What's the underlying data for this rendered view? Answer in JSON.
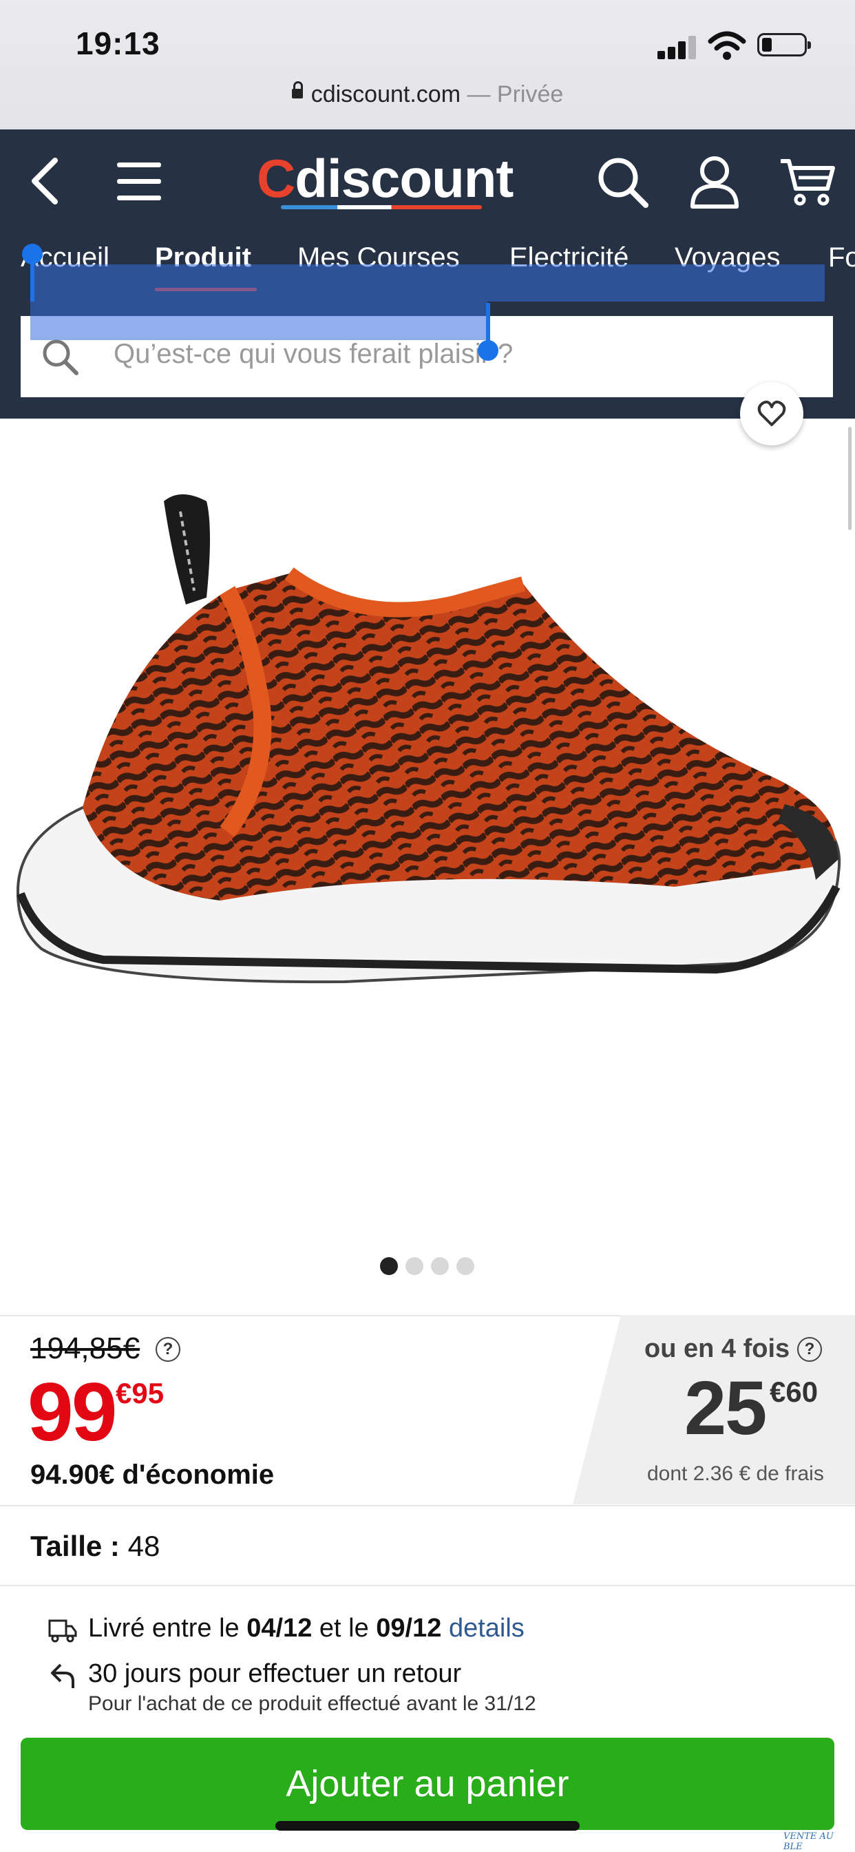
{
  "status_bar": {
    "time": "19:13"
  },
  "browser": {
    "domain": "cdiscount.com",
    "mode": " — Privée"
  },
  "header": {
    "logo_c": "C",
    "logo_rest": "discount",
    "tabs": [
      "Accueil",
      "Produit",
      "Mes Courses",
      "Electricité",
      "Voyages",
      "Fo"
    ],
    "active_tab": "Produit",
    "search_placeholder": "Qu’est-ce qui vous ferait plaisir ?"
  },
  "gallery": {
    "image_count": 4,
    "current_index": 1
  },
  "price": {
    "old_price": "194,85€",
    "help": "?",
    "price_int": "99",
    "price_cents": "€95",
    "savings": "94.90€ d'économie",
    "installment_label": "ou en 4 fois",
    "installment_int": "25",
    "installment_cents": "€60",
    "installment_fees": "dont 2.36 € de frais"
  },
  "size": {
    "label": "Taille :",
    "value": " 48"
  },
  "delivery": {
    "prefix": "Livré entre le ",
    "date_from": "04/12",
    "middle": " et le ",
    "date_to": "09/12",
    "link": "details"
  },
  "returns": {
    "title": "30 jours pour effectuer un retour",
    "subtitle": "Pour l'achat de ce produit effectué avant le 31/12"
  },
  "cart_button": "Ajouter au panier",
  "watermark": "VENTE AU BLE",
  "colors": {
    "header_bg": "#263244",
    "brand_red": "#e8412c",
    "price_red": "#e30613",
    "cart_green": "#2aad1b"
  }
}
